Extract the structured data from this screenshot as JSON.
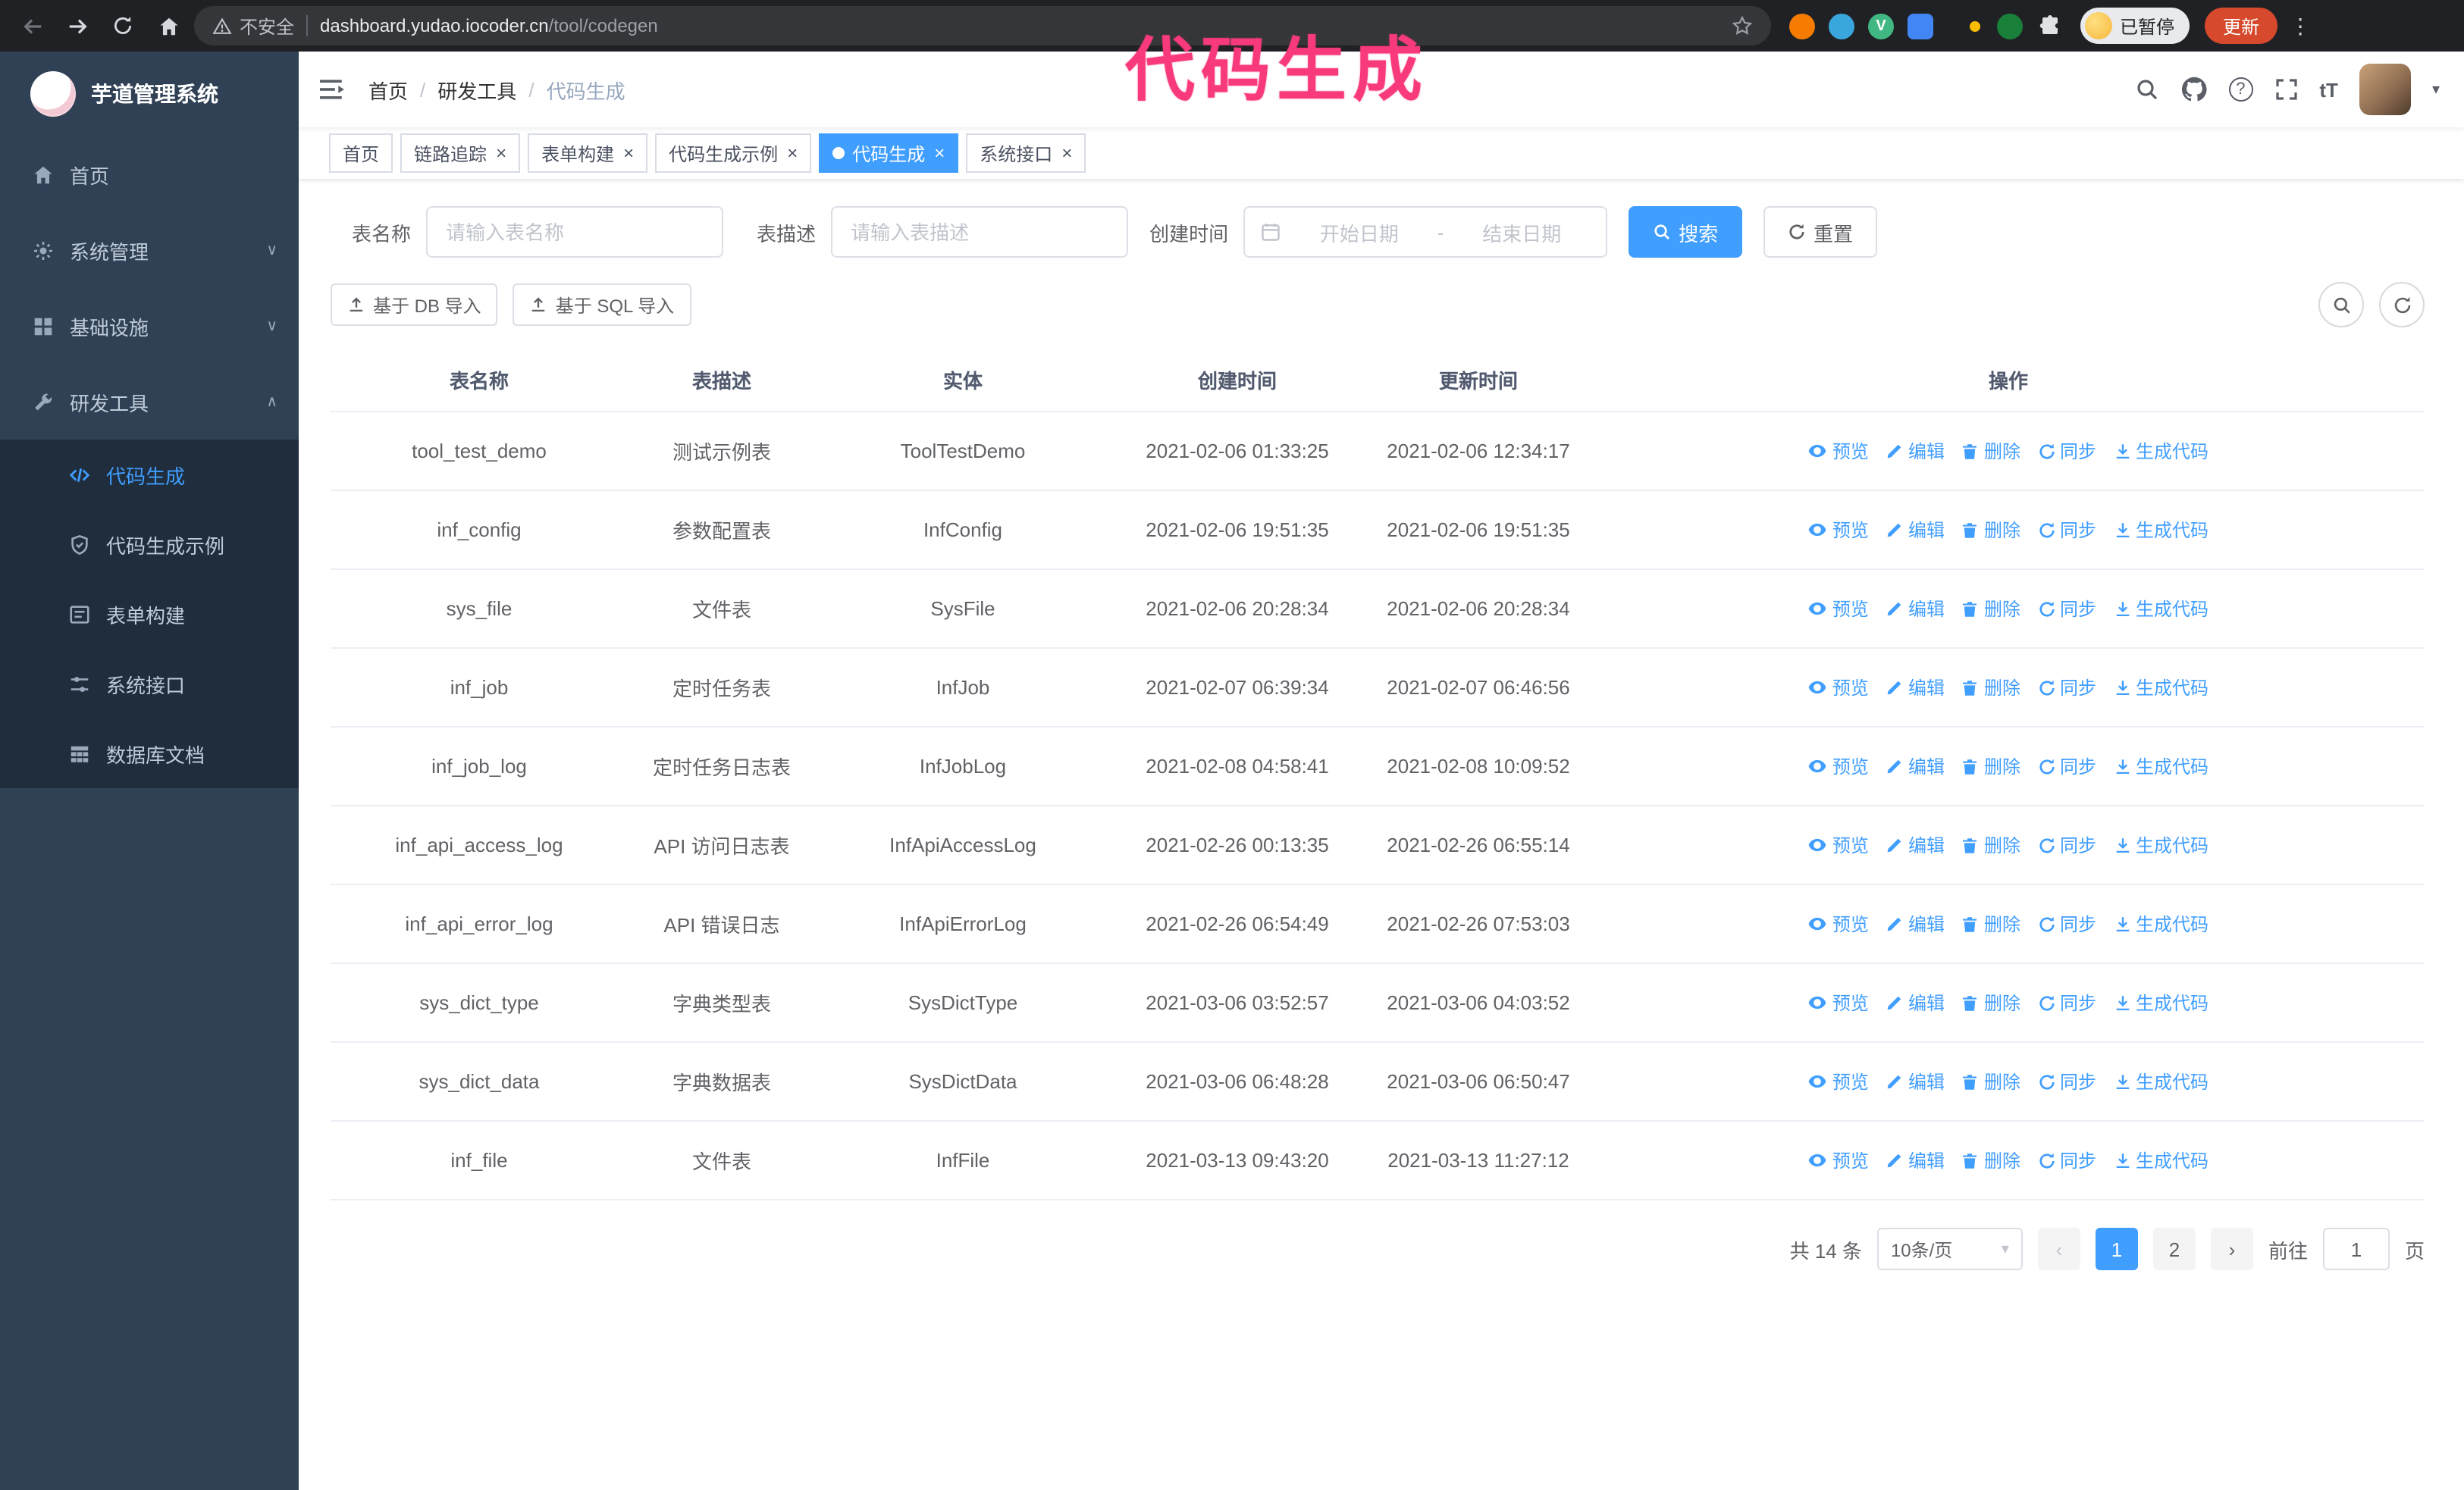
{
  "annotation": {
    "text": "代码生成",
    "color": "#f83a7c"
  },
  "browser": {
    "security_label": "不安全",
    "url_domain": "dashboard.yudao.iocoder.cn",
    "url_path": "/tool/codegen",
    "paused_badge": "已暂停",
    "update_button": "更新",
    "extensions": [
      {
        "name": "extension-icon",
        "color": "#f57c00",
        "shape": "circle",
        "glyph": ""
      },
      {
        "name": "extension-icon",
        "color": "#39a7dd",
        "shape": "circle",
        "glyph": ""
      },
      {
        "name": "extension-icon",
        "color": "#41b883",
        "shape": "circle",
        "glyph": "V"
      },
      {
        "name": "extension-icon",
        "color": "#4285f4",
        "shape": "square",
        "glyph": ""
      },
      {
        "name": "extension-icon",
        "color": "#202124",
        "shape": "pill",
        "accent": "#fbbc04",
        "glyph": ""
      },
      {
        "name": "extension-icon",
        "color": "#188038",
        "shape": "circle",
        "glyph": ""
      },
      {
        "name": "puzzle-icon",
        "color": "#dfe1e5",
        "shape": "puzzle",
        "glyph": ""
      }
    ]
  },
  "sidebar": {
    "title": "芋道管理系统",
    "items": [
      {
        "label": "首页",
        "icon": "home-icon",
        "expandable": false,
        "expanded": false
      },
      {
        "label": "系统管理",
        "icon": "gear-icon",
        "expandable": true,
        "expanded": false
      },
      {
        "label": "基础设施",
        "icon": "infra-icon",
        "expandable": true,
        "expanded": false
      },
      {
        "label": "研发工具",
        "icon": "tools-icon",
        "expandable": true,
        "expanded": true
      }
    ],
    "submenu": [
      {
        "label": "代码生成",
        "icon": "code-icon",
        "active": true
      },
      {
        "label": "代码生成示例",
        "icon": "shield-icon",
        "active": false
      },
      {
        "label": "表单构建",
        "icon": "form-icon",
        "active": false
      },
      {
        "label": "系统接口",
        "icon": "api-icon",
        "active": false
      },
      {
        "label": "数据库文档",
        "icon": "db-icon",
        "active": false
      }
    ]
  },
  "header": {
    "breadcrumb": [
      "首页",
      "研发工具",
      "代码生成"
    ],
    "breadcrumb_separator": "/"
  },
  "tabs": [
    {
      "label": "首页",
      "closable": false,
      "active": false
    },
    {
      "label": "链路追踪",
      "closable": true,
      "active": false
    },
    {
      "label": "表单构建",
      "closable": true,
      "active": false
    },
    {
      "label": "代码生成示例",
      "closable": true,
      "active": false
    },
    {
      "label": "代码生成",
      "closable": true,
      "active": true
    },
    {
      "label": "系统接口",
      "closable": true,
      "active": false
    }
  ],
  "filters": {
    "table_name_label": "表名称",
    "table_name_placeholder": "请输入表名称",
    "table_desc_label": "表描述",
    "table_desc_placeholder": "请输入表描述",
    "create_time_label": "创建时间",
    "date_start_placeholder": "开始日期",
    "date_separator": "-",
    "date_end_placeholder": "结束日期",
    "search_button": "搜索",
    "reset_button": "重置"
  },
  "toolbar": {
    "import_db_button": "基于 DB 导入",
    "import_sql_button": "基于 SQL 导入"
  },
  "table": {
    "columns": [
      "表名称",
      "表描述",
      "实体",
      "创建时间",
      "更新时间",
      "操作"
    ],
    "actions": [
      "预览",
      "编辑",
      "删除",
      "同步",
      "生成代码"
    ],
    "rows": [
      {
        "name": "tool_test_demo",
        "desc": "测试示例表",
        "entity": "ToolTestDemo",
        "created": "2021-02-06 01:33:25",
        "updated": "2021-02-06 12:34:17"
      },
      {
        "name": "inf_config",
        "desc": "参数配置表",
        "entity": "InfConfig",
        "created": "2021-02-06 19:51:35",
        "updated": "2021-02-06 19:51:35"
      },
      {
        "name": "sys_file",
        "desc": "文件表",
        "entity": "SysFile",
        "created": "2021-02-06 20:28:34",
        "updated": "2021-02-06 20:28:34"
      },
      {
        "name": "inf_job",
        "desc": "定时任务表",
        "entity": "InfJob",
        "created": "2021-02-07 06:39:34",
        "updated": "2021-02-07 06:46:56"
      },
      {
        "name": "inf_job_log",
        "desc": "定时任务日志表",
        "entity": "InfJobLog",
        "created": "2021-02-08 04:58:41",
        "updated": "2021-02-08 10:09:52"
      },
      {
        "name": "inf_api_access_log",
        "desc": "API 访问日志表",
        "entity": "InfApiAccessLog",
        "created": "2021-02-26 00:13:35",
        "updated": "2021-02-26 06:55:14"
      },
      {
        "name": "inf_api_error_log",
        "desc": "API 错误日志",
        "entity": "InfApiErrorLog",
        "created": "2021-02-26 06:54:49",
        "updated": "2021-02-26 07:53:03"
      },
      {
        "name": "sys_dict_type",
        "desc": "字典类型表",
        "entity": "SysDictType",
        "created": "2021-03-06 03:52:57",
        "updated": "2021-03-06 04:03:52"
      },
      {
        "name": "sys_dict_data",
        "desc": "字典数据表",
        "entity": "SysDictData",
        "created": "2021-03-06 06:48:28",
        "updated": "2021-03-06 06:50:47"
      },
      {
        "name": "inf_file",
        "desc": "文件表",
        "entity": "InfFile",
        "created": "2021-03-13 09:43:20",
        "updated": "2021-03-13 11:27:12"
      }
    ]
  },
  "pagination": {
    "total": "共 14 条",
    "page_size": "10条/页",
    "pages": [
      "1",
      "2"
    ],
    "current": "1",
    "goto_prefix": "前往",
    "goto_value": "1",
    "goto_suffix": "页"
  },
  "colors": {
    "accent": "#409eff",
    "sidebar_bg": "#304156",
    "submenu_bg": "#1f2d3d",
    "annotation": "#f83a7c",
    "update_button": "#d6492c"
  }
}
